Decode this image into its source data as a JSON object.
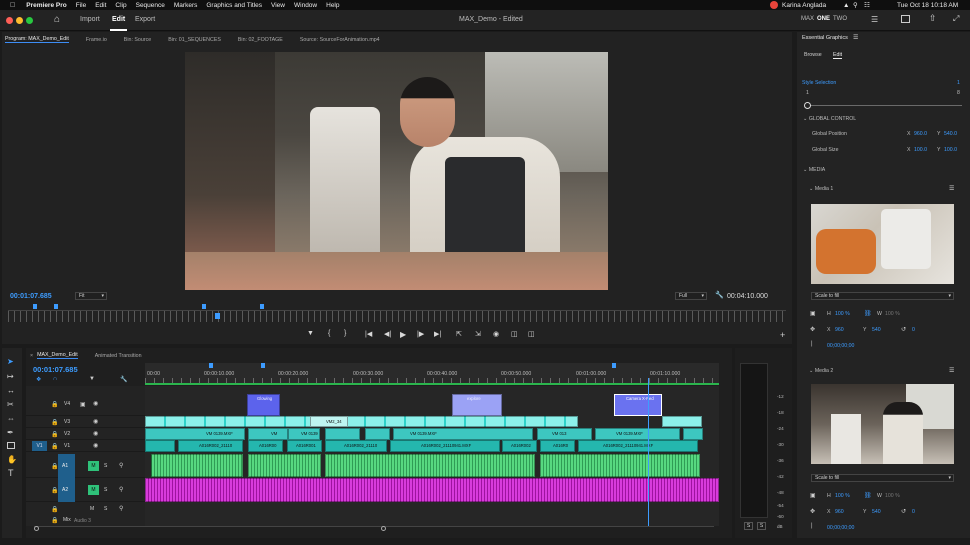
{
  "menubar": {
    "app": "Premiere Pro",
    "items": [
      "File",
      "Edit",
      "Clip",
      "Sequence",
      "Markers",
      "Graphics and Titles",
      "View",
      "Window",
      "Help"
    ],
    "user": "Karina Anglada",
    "datetime": "Tue Oct 18  10:18 AM"
  },
  "header": {
    "tabs": [
      "Import",
      "Edit",
      "Export"
    ],
    "active_tab": "Edit",
    "title": "MAX_Demo",
    "title_status": "- Edited",
    "workspaces": [
      "MAX",
      "ONE",
      "TWO"
    ]
  },
  "program": {
    "tabs": [
      "Program: MAX_Demo_Edit",
      "Frame.io",
      "Bin: Source",
      "Bin: 01_SEQUENCES",
      "Bin: 02_FOOTAGE",
      "Source: SourceForAnimation.mp4"
    ],
    "timecode": "00:01:07.685",
    "fit": "Fit",
    "quality": "Full",
    "duration": "00:04:10.000"
  },
  "timeline": {
    "tabs": [
      "MAX_Demo_Edit",
      "Animated Transition"
    ],
    "timecode": "00:01:07.685",
    "ruler": [
      "00:00",
      "00:00:10.000",
      "00:00:20.000",
      "00:00:30.000",
      "00:00:40.000",
      "00:00:50.000",
      "00:01:00.000",
      "00:01:10.000"
    ],
    "tracks": {
      "V4": "V4",
      "V3": "V3",
      "V2": "V2",
      "V1": "V1",
      "A1": "A1",
      "A2": "A2",
      "M": "M",
      "S": "S",
      "source_v1": "V1",
      "mix": "Mix",
      "audio3": "Audio 3"
    },
    "clips": {
      "v4a": "Glowing",
      "v4b": "explore",
      "v4c": "Camera X-Ped",
      "v3a": "VM2_34",
      "v2a": "VM 0139.MXF",
      "v2b": "VM",
      "v2c": "VM 0139",
      "v2d": "VM 0139.MXF",
      "v2e": "VM 0139.MXF",
      "v2f": "VM 013",
      "v2g": "VM 0139.MXF",
      "v1a": "A01",
      "v1b": "A016R002_21110",
      "v1c": "A016R00",
      "v1d": "A016R001",
      "v1e": "A016R002_21110",
      "v1f": "A016R002_21110941.MXF",
      "v1g": "A016R002",
      "v1h": "A016R0",
      "v1i": "A016R002_21110941.MXF"
    },
    "meter": [
      "-12",
      "-18",
      "-24",
      "-30",
      "-36",
      "-42",
      "-48",
      "-54",
      "-60",
      "dB"
    ],
    "meter_solo": "S"
  },
  "essential": {
    "title": "Essential Graphics",
    "tabs": [
      "Browse",
      "Edit"
    ],
    "style_selection": "Style Selection",
    "style_min": "1",
    "style_max": "8",
    "style_value": "1",
    "global_control": "GLOBAL CONTROL",
    "global_position": "Global Position",
    "pos_x_label": "X",
    "pos_x": "960.0",
    "pos_y_label": "Y",
    "pos_y": "540.0",
    "global_size": "Global Size",
    "size_x_label": "X",
    "size_x": "100.0",
    "size_y_label": "Y",
    "size_y": "100.0",
    "media": "MEDIA",
    "media1": {
      "name": "Media 1",
      "scale": "Scale to fill",
      "h_label": "H",
      "h": "100 %",
      "w_label": "W",
      "w": "100 %",
      "x_label": "X",
      "x": "960",
      "y_label": "Y",
      "y": "540",
      "rot": "0",
      "tc": "00;00;00;00"
    },
    "media2": {
      "name": "Media 2",
      "scale": "Scale to fill",
      "h_label": "H",
      "h": "100 %",
      "w_label": "W",
      "w": "100 %",
      "x_label": "X",
      "x": "960",
      "y_label": "Y",
      "y": "540",
      "rot": "0",
      "tc": "00;00;00;00"
    }
  },
  "colors": {
    "accent": "#3d9cff",
    "cyan_clip": "#2ed2c9",
    "graphic_clip": "#9ba2f5",
    "audio_clip": "#3ec06a",
    "audio_magenta": "#c620c8",
    "playhead": "#3d9cff"
  }
}
